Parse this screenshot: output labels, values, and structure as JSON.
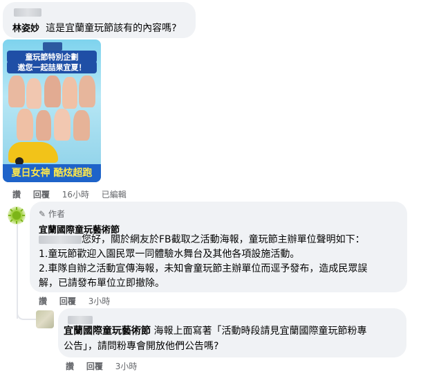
{
  "comment1": {
    "author": "林姿妙",
    "text": "這是宜蘭童玩節該有的內容嗎?",
    "poster": {
      "title_line1": "童玩節特別企劃",
      "title_line2": "邀您一起喆果宜夏！",
      "banner": "夏日女神 酷炫超跑"
    },
    "actions": {
      "like": "讚",
      "reply": "回覆",
      "time": "16小時",
      "edited": "已編輯"
    }
  },
  "reply1": {
    "author_badge": "作者",
    "author": "宜蘭國際童玩藝術節",
    "line1": "您好，關於網友於FB截取之活動海報，童玩節主辦單位聲明如下：",
    "line2": "1.童玩節歡迎入園民眾一同體驗水舞台及其他各項設施活動。",
    "line3": "2.車隊自辦之活動宣傳海報，未知會童玩節主辦單位而逕予發布，造成民眾誤",
    "line4": "解，已請發布單位立即撤除。",
    "actions": {
      "like": "讚",
      "reply": "回覆",
      "time": "3小時"
    }
  },
  "reply2": {
    "mention": "宜蘭國際童玩藝術節",
    "text_line1": "海報上面寫著「活動時段請見宜蘭國際童玩節粉專",
    "text_line2": "公告」，請問粉專會開放他們公告嗎?",
    "actions": {
      "like": "讚",
      "reply": "回覆",
      "time": "3小時"
    }
  },
  "colors": {
    "bubble": "#f0f2f5",
    "meta": "#65676b",
    "banner": "#1e63c9"
  }
}
